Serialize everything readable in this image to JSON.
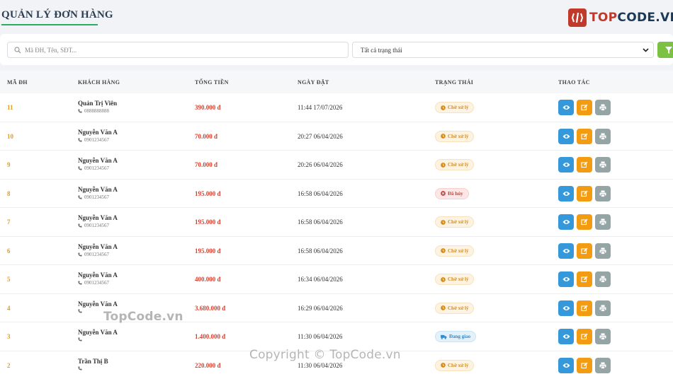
{
  "page": {
    "title": "QUẢN LÝ ĐƠN HÀNG"
  },
  "logo": {
    "prefix": "TOP",
    "suffix": "CODE.VN",
    "brand_color": "#c0392b"
  },
  "filters": {
    "search_placeholder": "Mã ĐH, Tên, SĐT...",
    "status_selected": "Tất cả trạng thái",
    "filter_button_color": "#7bc142"
  },
  "table": {
    "headers": {
      "id": "MÃ ĐH",
      "customer": "KHÁCH HÀNG",
      "total": "TỔNG TIỀN",
      "date": "NGÀY ĐẶT",
      "status": "TRẠNG THÁI",
      "actions": "THAO TÁC"
    },
    "rows": [
      {
        "id": "11",
        "name": "Quản Trị Viên",
        "phone": "0888888888",
        "total": "390.000 đ",
        "date": "11:44 17/07/2026",
        "status": "Chờ xử lý",
        "status_type": "pending"
      },
      {
        "id": "10",
        "name": "Nguyễn Văn A",
        "phone": "0901234567",
        "total": "70.000 đ",
        "date": "20:27 06/04/2026",
        "status": "Chờ xử lý",
        "status_type": "pending"
      },
      {
        "id": "9",
        "name": "Nguyễn Văn A",
        "phone": "0901234567",
        "total": "70.000 đ",
        "date": "20:26 06/04/2026",
        "status": "Chờ xử lý",
        "status_type": "pending"
      },
      {
        "id": "8",
        "name": "Nguyễn Văn A",
        "phone": "0901234567",
        "total": "195.000 đ",
        "date": "16:58 06/04/2026",
        "status": "Đã hủy",
        "status_type": "cancelled"
      },
      {
        "id": "7",
        "name": "Nguyễn Văn A",
        "phone": "0901234567",
        "total": "195.000 đ",
        "date": "16:58 06/04/2026",
        "status": "Chờ xử lý",
        "status_type": "pending"
      },
      {
        "id": "6",
        "name": "Nguyễn Văn A",
        "phone": "0901234567",
        "total": "195.000 đ",
        "date": "16:58 06/04/2026",
        "status": "Chờ xử lý",
        "status_type": "pending"
      },
      {
        "id": "5",
        "name": "Nguyễn Văn A",
        "phone": "0901234567",
        "total": "400.000 đ",
        "date": "16:34 06/04/2026",
        "status": "Chờ xử lý",
        "status_type": "pending"
      },
      {
        "id": "4",
        "name": "Nguyễn Văn A",
        "phone": "",
        "total": "3.680.000 đ",
        "date": "16:29 06/04/2026",
        "status": "Chờ xử lý",
        "status_type": "pending"
      },
      {
        "id": "3",
        "name": "Nguyễn Văn A",
        "phone": "",
        "total": "1.400.000 đ",
        "date": "11:30 06/04/2026",
        "status": "Đang giao",
        "status_type": "shipping"
      },
      {
        "id": "2",
        "name": "Trần Thị B",
        "phone": "",
        "total": "220.000 đ",
        "date": "11:30 06/04/2026",
        "status": "Chờ xử lý",
        "status_type": "pending"
      }
    ]
  },
  "watermarks": {
    "top": "TopCode.vn",
    "bottom": "Copyright © TopCode.vn"
  }
}
